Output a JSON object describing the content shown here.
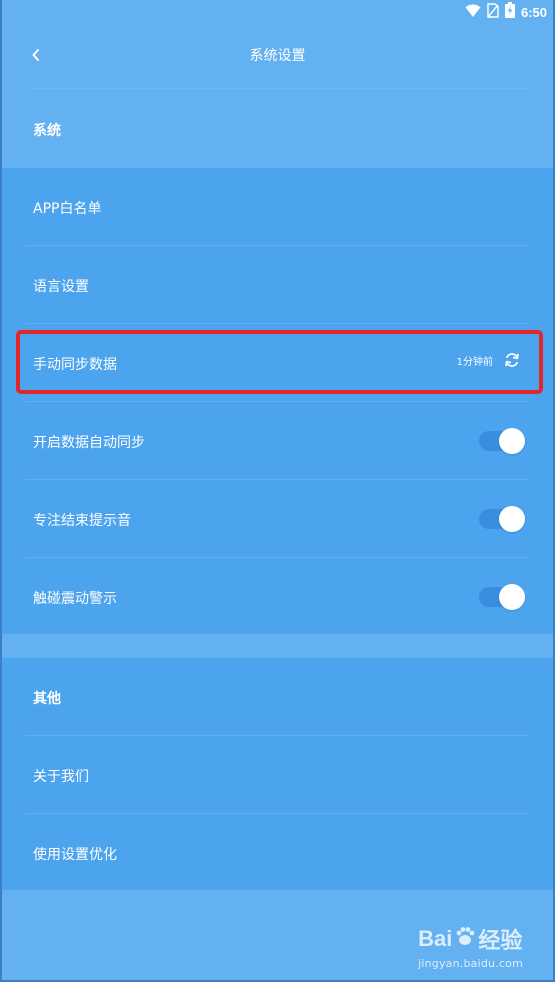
{
  "status_bar": {
    "time": "6:50",
    "icons": [
      "wifi-icon",
      "no-sim-icon",
      "battery-charging-icon"
    ]
  },
  "title_bar": {
    "back_icon": "chevron-left-icon",
    "title": "系统设置"
  },
  "system_section": {
    "header": "系统",
    "rows": [
      {
        "label": "APP白名单"
      },
      {
        "label": "语言设置"
      },
      {
        "label": "手动同步数据",
        "meta": "1分钟前",
        "icon": "refresh-icon",
        "highlighted": true
      },
      {
        "label": "开启数据自动同步",
        "toggle": true
      },
      {
        "label": "专注结束提示音",
        "toggle": true
      },
      {
        "label": "触碰震动警示",
        "toggle": true
      }
    ]
  },
  "other_section": {
    "header": "其他",
    "rows": [
      {
        "label": "关于我们"
      },
      {
        "label": "使用设置优化"
      }
    ]
  },
  "watermark": {
    "brand_left": "Bai",
    "brand_right": "经验",
    "url": "jingyan.baidu.com"
  },
  "colors": {
    "background": "#64b1f2",
    "panel": "#4da4ee",
    "highlight": "#e3262a",
    "toggle_track": "#3a8ee0"
  }
}
